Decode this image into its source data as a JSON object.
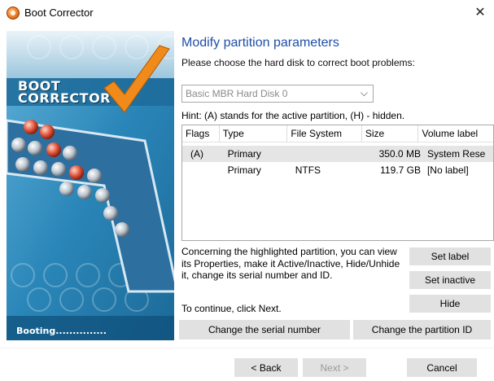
{
  "window": {
    "title": "Boot Corrector",
    "close_glyph": "✕",
    "icon": "app-disc-icon"
  },
  "banner": {
    "title_line1": "BOOT",
    "title_line2": "CORRECTOR",
    "status_text": "Booting..............."
  },
  "main": {
    "heading": "Modify partition parameters",
    "subheading": "Please choose the hard disk to correct boot problems:",
    "disk_select": {
      "value": "Basic MBR Hard Disk 0",
      "chevron": "⌵"
    },
    "hint": "Hint: (A) stands for the active partition, (H) - hidden.",
    "table": {
      "columns": [
        "Flags",
        "Type",
        "File System",
        "Size",
        "Volume label"
      ],
      "rows": [
        {
          "flags": "(A)",
          "type": "Primary",
          "fs": "",
          "size": "350.0 MB",
          "label": "System Rese",
          "selected": true
        },
        {
          "flags": "",
          "type": "Primary",
          "fs": "NTFS",
          "size": "119.7 GB",
          "label": "[No label]",
          "selected": false
        }
      ]
    },
    "description": "Concerning the highlighted partition, you can view its Properties, make it Active/Inactive, Hide/Unhide it, change its serial number and ID.",
    "continue_text": "To continue, click Next.",
    "buttons": {
      "set_label": "Set label",
      "set_inactive": "Set inactive",
      "hide": "Hide",
      "change_serial": "Change the serial number",
      "change_id": "Change the partition ID"
    }
  },
  "footer": {
    "back": "< Back",
    "next": "Next >",
    "cancel": "Cancel"
  },
  "colors": {
    "heading": "#1e4fa8",
    "button_bg": "#e1e1e1",
    "selected_row": "#e5e5e5",
    "banner_blue": "#2a7fb0"
  }
}
